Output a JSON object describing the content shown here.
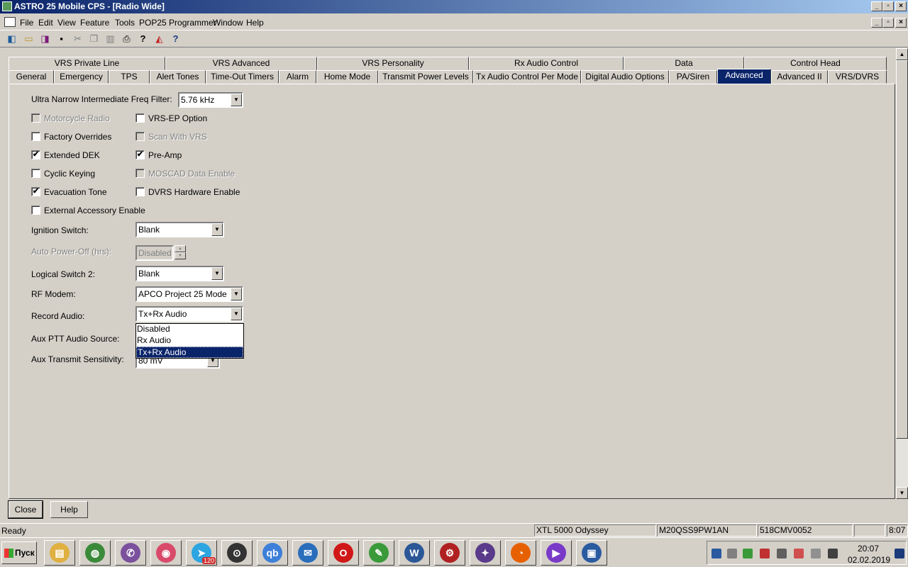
{
  "window": {
    "title": "ASTRO 25 Mobile CPS - [Radio Wide]",
    "min": "_",
    "max": "▫",
    "close": "×"
  },
  "menu": {
    "items": [
      "File",
      "Edit",
      "View",
      "Feature",
      "Tools",
      "POP25 Programmer",
      "Window",
      "Help"
    ],
    "mdi_min": "_",
    "mdi_max": "▫",
    "mdi_close": "×"
  },
  "toolbar": {
    "icons": [
      "read-radio-icon",
      "open-icon",
      "write-radio-icon",
      "save-icon",
      "cut-icon",
      "copy-icon",
      "paste-icon",
      "print-icon",
      "help-icon",
      "chart-icon",
      "context-help-icon"
    ]
  },
  "tabs": {
    "row1": [
      "VRS Private Line",
      "VRS Advanced",
      "VRS Personality",
      "Rx Audio Control",
      "Data",
      "Control Head"
    ],
    "row2": [
      "General",
      "Emergency",
      "TPS",
      "Alert Tones",
      "Time-Out Timers",
      "Alarm",
      "Home Mode",
      "Transmit Power Levels",
      "Tx Audio Control Per Mode",
      "Digital Audio Options",
      "PA/Siren",
      "Advanced",
      "Advanced II",
      "VRS/DVRS"
    ],
    "active": "Advanced"
  },
  "form": {
    "uni_filter_label": "Ultra Narrow Intermediate Freq Filter:",
    "uni_filter_value": "5.76 kHz",
    "checkboxes_left": [
      {
        "label": "Motorcycle Radio",
        "checked": false,
        "enabled": false
      },
      {
        "label": "Factory Overrides",
        "checked": false,
        "enabled": true
      },
      {
        "label": "Extended DEK",
        "checked": true,
        "enabled": true
      },
      {
        "label": "Cyclic Keying",
        "checked": false,
        "enabled": true
      },
      {
        "label": "Evacuation Tone",
        "checked": true,
        "enabled": true
      },
      {
        "label": "External Accessory Enable",
        "checked": false,
        "enabled": true
      }
    ],
    "checkboxes_right": [
      {
        "label": "VRS-EP Option",
        "checked": false,
        "enabled": true
      },
      {
        "label": "Scan With VRS",
        "checked": false,
        "enabled": false
      },
      {
        "label": "Pre-Amp",
        "checked": true,
        "enabled": true
      },
      {
        "label": "MOSCAD Data Enable",
        "checked": false,
        "enabled": false
      },
      {
        "label": "DVRS Hardware Enable",
        "checked": false,
        "enabled": true
      }
    ],
    "ignition_label": "Ignition Switch:",
    "ignition_value": "Blank",
    "autopower_label": "Auto Power-Off (hrs):",
    "autopower_value": "Disabled",
    "logical2_label": "Logical Switch 2:",
    "logical2_value": "Blank",
    "rfmodem_label": "RF Modem:",
    "rfmodem_value": "APCO Project 25 Mode",
    "record_label": "Record Audio:",
    "record_value": "Tx+Rx Audio",
    "auxptt_label": "Aux PTT Audio Source:",
    "auxtx_label": "Aux Transmit Sensitivity:",
    "auxtx_value": "80 mV",
    "record_options": [
      "Disabled",
      "Rx Audio",
      "Tx+Rx Audio"
    ],
    "record_selected": "Tx+Rx Audio",
    "check_glyph": "✔",
    "down_glyph": "▼"
  },
  "buttons": {
    "close": "Close",
    "help": "Help"
  },
  "status": {
    "text": "Ready",
    "model": "XTL 5000 Odyssey",
    "serial": "M20QSS9PW1AN",
    "code": "518CMV0052",
    "time": "8:07"
  },
  "taskbar": {
    "start": "Пуск",
    "apps": [
      {
        "name": "explorer-icon",
        "color": "#e0b040",
        "glyph": "▤"
      },
      {
        "name": "globe-icon",
        "color": "#3a8a3a",
        "glyph": "◍"
      },
      {
        "name": "viber-icon",
        "color": "#7b519d",
        "glyph": "✆"
      },
      {
        "name": "browser-icon",
        "color": "#d94a6a",
        "glyph": "◉"
      },
      {
        "name": "telegram-icon",
        "color": "#2ca5e0",
        "glyph": "➤"
      },
      {
        "name": "lock-icon",
        "color": "#333333",
        "glyph": "⊙"
      },
      {
        "name": "qbittorrent-icon",
        "color": "#3d7fd9",
        "glyph": "qb"
      },
      {
        "name": "thunderbird-icon",
        "color": "#2a6ebb",
        "glyph": "✉"
      },
      {
        "name": "opera-icon",
        "color": "#d01818",
        "glyph": "O"
      },
      {
        "name": "edit-icon",
        "color": "#3a9a3a",
        "glyph": "✎"
      },
      {
        "name": "word-icon",
        "color": "#2b5797",
        "glyph": "W"
      },
      {
        "name": "settings-icon",
        "color": "#b02020",
        "glyph": "⚙"
      },
      {
        "name": "ball-icon",
        "color": "#5a3a8a",
        "glyph": "✦"
      },
      {
        "name": "firefox-icon",
        "color": "#e66000",
        "glyph": "◔"
      },
      {
        "name": "media-icon",
        "color": "#7a3ac8",
        "glyph": "▶"
      },
      {
        "name": "cps-icon",
        "color": "#2a5aa0",
        "glyph": "▣"
      }
    ],
    "telegram_badge": "120",
    "clock_time": "20:07",
    "clock_date": "02.02.2019"
  }
}
